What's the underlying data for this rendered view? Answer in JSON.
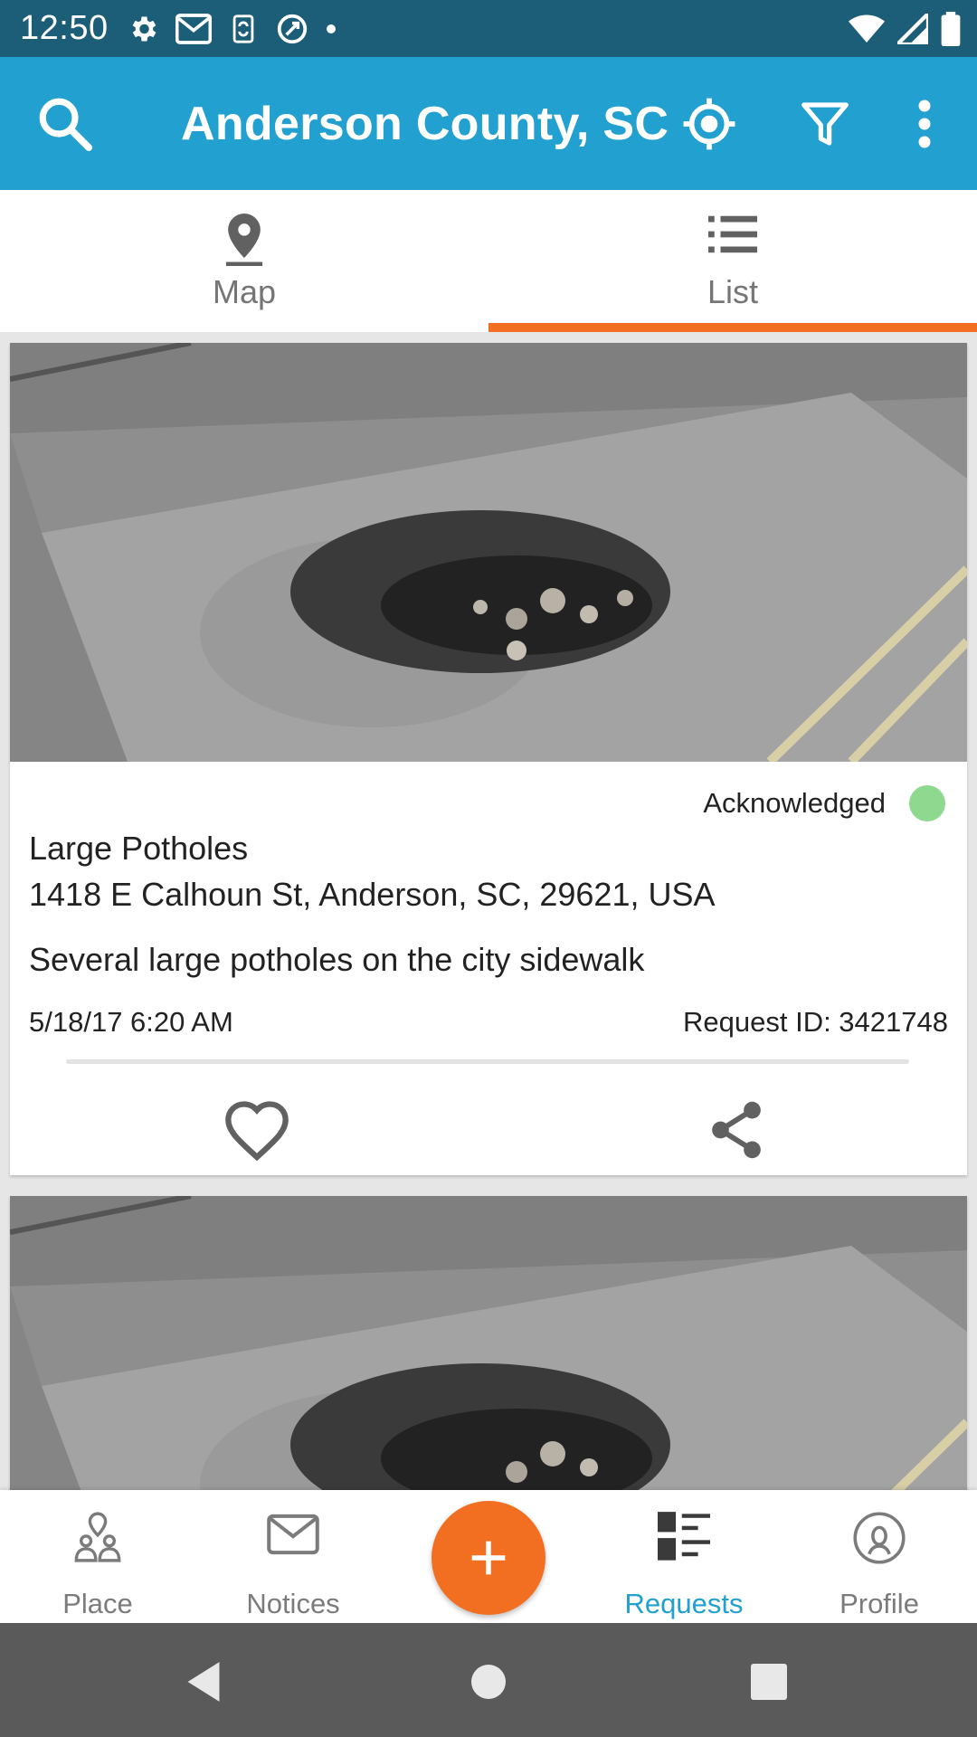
{
  "status_bar": {
    "time": "12:50",
    "icons": [
      "settings-icon",
      "gmail-icon",
      "sync-icon",
      "data-saver-icon",
      "dot-icon",
      "wifi-icon",
      "signal-icon",
      "battery-icon"
    ]
  },
  "app_bar": {
    "title": "Anderson County, SC",
    "icons": [
      "search-icon",
      "my-location-icon",
      "filter-icon",
      "more-vert-icon"
    ]
  },
  "tabs": [
    {
      "label": "Map",
      "icon": "map-pin-icon",
      "selected": false
    },
    {
      "label": "List",
      "icon": "list-icon",
      "selected": true
    }
  ],
  "requests": [
    {
      "status": "Acknowledged",
      "status_color": "#8fd88f",
      "title": "Large Potholes",
      "address": "1418 E Calhoun St, Anderson, SC, 29621, USA",
      "description": "Several large potholes on the city sidewalk",
      "date": "5/18/17 6:20 AM",
      "request_id": "Request ID: 3421748"
    }
  ],
  "bottom_nav": [
    {
      "label": "Place",
      "icon": "place-icon",
      "active": false
    },
    {
      "label": "Notices",
      "icon": "envelope-icon",
      "active": false
    },
    {
      "label": "Requests",
      "icon": "requests-icon",
      "active": true
    },
    {
      "label": "Profile",
      "icon": "profile-icon",
      "active": false
    }
  ],
  "fab": {
    "icon": "plus-icon"
  },
  "colors": {
    "status_bar": "#1c5d77",
    "app_bar": "#22a0cf",
    "accent_orange": "#f26f21",
    "active_nav": "#22a0cf",
    "system_nav": "#5a5a5a"
  }
}
